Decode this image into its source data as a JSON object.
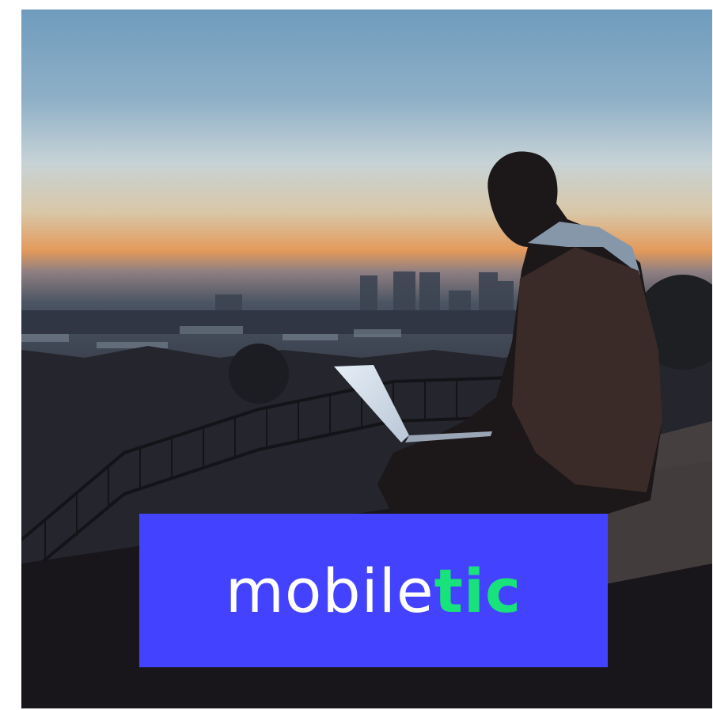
{
  "photo": {
    "scene": "person-with-laptop-on-hilltop-at-dusk-over-city",
    "colors": {
      "sky_top": "#6f9cbd",
      "sky_mid": "#c7d3d6",
      "horizon_glow": "#e39a5b",
      "city_haze": "#4a5462",
      "foreground": "#1d1a20"
    }
  },
  "logo": {
    "text_regular": "mobile",
    "text_bold": "tic",
    "colors": {
      "background": "#4343ff",
      "regular": "#ffffff",
      "bold": "#18e27a"
    }
  }
}
